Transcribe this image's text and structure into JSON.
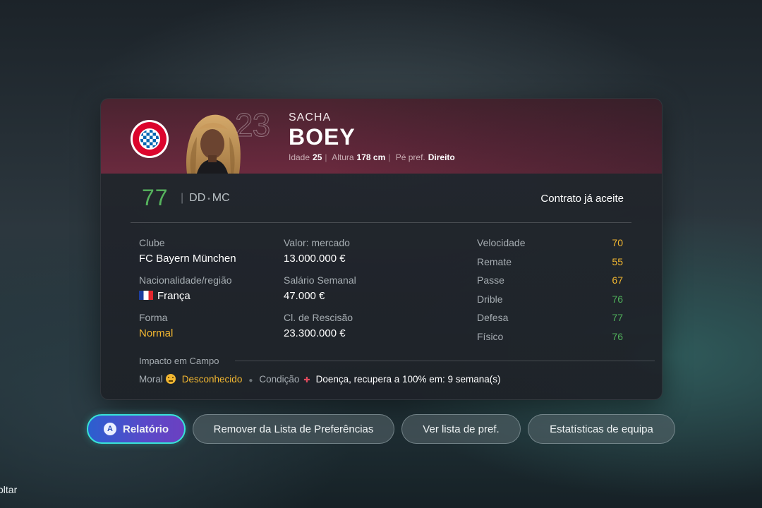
{
  "player": {
    "first_name": "SACHA",
    "last_name": "BOEY",
    "number": "23",
    "age_label": "Idade",
    "age": "25",
    "height_label": "Altura",
    "height": "178 cm",
    "foot_label": "Pé pref.",
    "foot": "Direito",
    "overall": "77",
    "position_main": "DD",
    "position_alt": "MC",
    "contract_status": "Contrato já aceite"
  },
  "club_badge": {
    "icon": "fc-bayern-munchen-crest",
    "colors": [
      "#dc052d",
      "#0066b2",
      "#ffffff"
    ]
  },
  "info": {
    "club_label": "Clube",
    "club": "FC Bayern München",
    "nationality_label": "Nacionalidade/região",
    "nationality": "França",
    "form_label": "Forma",
    "form": "Normal",
    "market_value_label": "Valor: mercado",
    "market_value": "13.000.000 €",
    "wage_label": "Salário Semanal",
    "wage": "47.000 €",
    "release_label": "Cl. de Rescisão",
    "release": "23.300.000 €"
  },
  "stats": [
    {
      "label": "Velocidade",
      "value": "70",
      "color": "#f2b731"
    },
    {
      "label": "Remate",
      "value": "55",
      "color": "#f2b731"
    },
    {
      "label": "Passe",
      "value": "67",
      "color": "#f2b731"
    },
    {
      "label": "Drible",
      "value": "76",
      "color": "#4fae5a"
    },
    {
      "label": "Defesa",
      "value": "77",
      "color": "#4fae5a"
    },
    {
      "label": "Físico",
      "value": "76",
      "color": "#4fae5a"
    }
  ],
  "impact": {
    "title": "Impacto em Campo",
    "moral_label": "Moral",
    "moral_value": "Desconhecido",
    "condition_label": "Condição",
    "condition_value": "Doença, recupera a 100% em: 9 semana(s)"
  },
  "buttons": {
    "report_key": "A",
    "report": "Relatório",
    "remove_pref": "Remover da Lista de Preferências",
    "view_pref": "Ver lista de pref.",
    "team_stats": "Estatísticas de equipa"
  },
  "footer": {
    "back": "oltar"
  }
}
